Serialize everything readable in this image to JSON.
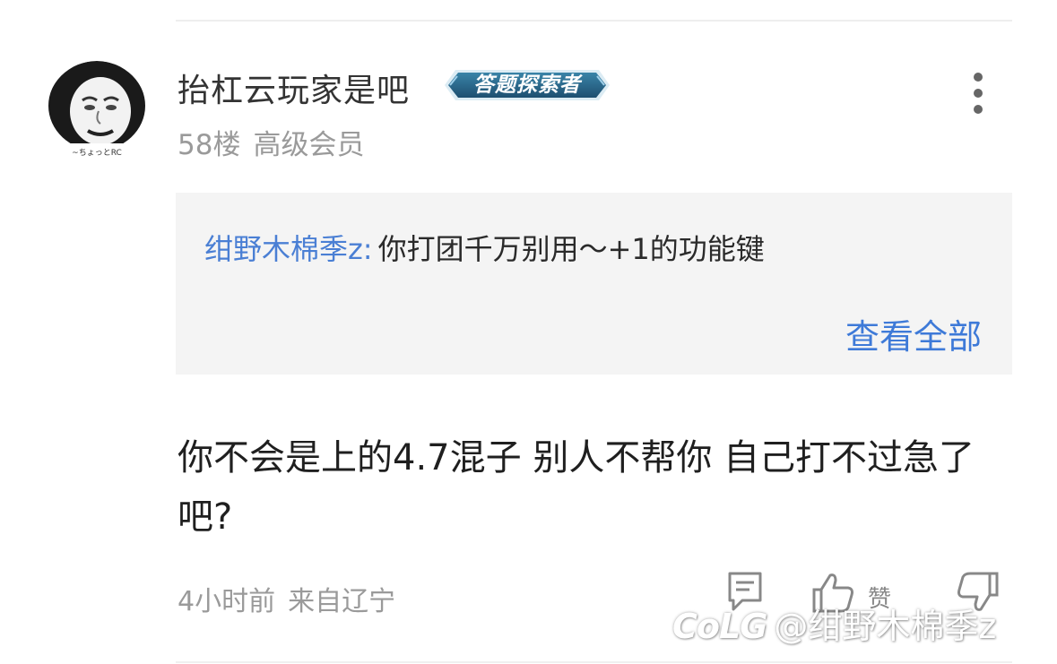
{
  "post": {
    "username": "抬杠云玩家是吧",
    "badge": "答题探索者",
    "floor": "58楼",
    "member_level": "高级会员",
    "avatar_caption": "~ちょっとRC"
  },
  "quote": {
    "author": "绀野木棉季z:",
    "text": "你打团千万别用～+1的功能键",
    "view_all": "查看全部"
  },
  "reply": {
    "text": "你不会是上的4.7混子 别人不帮你 自己打不过急了吧?"
  },
  "footer": {
    "time": "4小时前",
    "location": "来自辽宁",
    "like_label": "赞"
  },
  "watermark": {
    "logo": "CoLG",
    "handle": "@绀野木棉季z"
  },
  "colors": {
    "link_blue": "#3e7ad8",
    "quote_author_blue": "#4a7fd4",
    "badge_dark": "#1e4f70",
    "badge_light": "#3a84a8",
    "quote_background": "#f4f4f4"
  },
  "icons": {
    "more": "more-vertical-icon",
    "comment": "comment-icon",
    "like": "thumbs-up-icon",
    "dislike": "thumbs-down-icon"
  }
}
